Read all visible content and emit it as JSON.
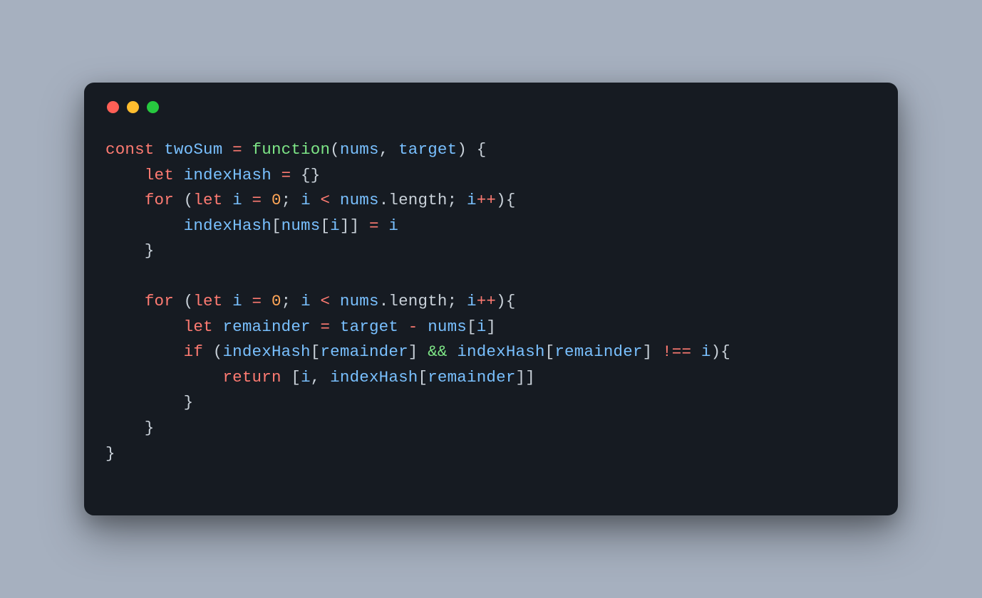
{
  "theme": {
    "background": "#a6b0bf",
    "window_bg": "#161b22",
    "dot_red": "#ff5f56",
    "dot_yellow": "#ffbd2e",
    "dot_green": "#27c93f",
    "text": "#c9d1d9",
    "keyword": "#ff7b72",
    "function": "#7ee787",
    "variable": "#79c0ff",
    "number": "#ffa657",
    "operator": "#ff7b72"
  },
  "code": {
    "language": "javascript",
    "tokens": [
      [
        {
          "t": "const",
          "c": "kw"
        },
        {
          "t": " ",
          "c": "punc"
        },
        {
          "t": "twoSum",
          "c": "var"
        },
        {
          "t": " ",
          "c": "punc"
        },
        {
          "t": "=",
          "c": "op"
        },
        {
          "t": " ",
          "c": "punc"
        },
        {
          "t": "function",
          "c": "green-kw"
        },
        {
          "t": "(",
          "c": "punc"
        },
        {
          "t": "nums",
          "c": "var"
        },
        {
          "t": ", ",
          "c": "punc"
        },
        {
          "t": "target",
          "c": "var"
        },
        {
          "t": ") {",
          "c": "punc"
        }
      ],
      [
        {
          "t": "    ",
          "c": "punc"
        },
        {
          "t": "let",
          "c": "kw"
        },
        {
          "t": " ",
          "c": "punc"
        },
        {
          "t": "indexHash",
          "c": "var"
        },
        {
          "t": " ",
          "c": "punc"
        },
        {
          "t": "=",
          "c": "op"
        },
        {
          "t": " {}",
          "c": "punc"
        }
      ],
      [
        {
          "t": "    ",
          "c": "punc"
        },
        {
          "t": "for",
          "c": "kw"
        },
        {
          "t": " (",
          "c": "punc"
        },
        {
          "t": "let",
          "c": "kw"
        },
        {
          "t": " ",
          "c": "punc"
        },
        {
          "t": "i",
          "c": "var"
        },
        {
          "t": " ",
          "c": "punc"
        },
        {
          "t": "=",
          "c": "op"
        },
        {
          "t": " ",
          "c": "punc"
        },
        {
          "t": "0",
          "c": "num"
        },
        {
          "t": "; ",
          "c": "punc"
        },
        {
          "t": "i",
          "c": "var"
        },
        {
          "t": " ",
          "c": "punc"
        },
        {
          "t": "<",
          "c": "op"
        },
        {
          "t": " ",
          "c": "punc"
        },
        {
          "t": "nums",
          "c": "var"
        },
        {
          "t": ".length; ",
          "c": "punc"
        },
        {
          "t": "i",
          "c": "var"
        },
        {
          "t": "++",
          "c": "op"
        },
        {
          "t": "){",
          "c": "punc"
        }
      ],
      [
        {
          "t": "        ",
          "c": "punc"
        },
        {
          "t": "indexHash",
          "c": "var"
        },
        {
          "t": "[",
          "c": "punc"
        },
        {
          "t": "nums",
          "c": "var"
        },
        {
          "t": "[",
          "c": "punc"
        },
        {
          "t": "i",
          "c": "var"
        },
        {
          "t": "]] ",
          "c": "punc"
        },
        {
          "t": "=",
          "c": "op"
        },
        {
          "t": " ",
          "c": "punc"
        },
        {
          "t": "i",
          "c": "var"
        }
      ],
      [
        {
          "t": "    }",
          "c": "punc"
        }
      ],
      [
        {
          "t": "",
          "c": "punc"
        }
      ],
      [
        {
          "t": "    ",
          "c": "punc"
        },
        {
          "t": "for",
          "c": "kw"
        },
        {
          "t": " (",
          "c": "punc"
        },
        {
          "t": "let",
          "c": "kw"
        },
        {
          "t": " ",
          "c": "punc"
        },
        {
          "t": "i",
          "c": "var"
        },
        {
          "t": " ",
          "c": "punc"
        },
        {
          "t": "=",
          "c": "op"
        },
        {
          "t": " ",
          "c": "punc"
        },
        {
          "t": "0",
          "c": "num"
        },
        {
          "t": "; ",
          "c": "punc"
        },
        {
          "t": "i",
          "c": "var"
        },
        {
          "t": " ",
          "c": "punc"
        },
        {
          "t": "<",
          "c": "op"
        },
        {
          "t": " ",
          "c": "punc"
        },
        {
          "t": "nums",
          "c": "var"
        },
        {
          "t": ".length; ",
          "c": "punc"
        },
        {
          "t": "i",
          "c": "var"
        },
        {
          "t": "++",
          "c": "op"
        },
        {
          "t": "){",
          "c": "punc"
        }
      ],
      [
        {
          "t": "        ",
          "c": "punc"
        },
        {
          "t": "let",
          "c": "kw"
        },
        {
          "t": " ",
          "c": "punc"
        },
        {
          "t": "remainder",
          "c": "var"
        },
        {
          "t": " ",
          "c": "punc"
        },
        {
          "t": "=",
          "c": "op"
        },
        {
          "t": " ",
          "c": "punc"
        },
        {
          "t": "target",
          "c": "var"
        },
        {
          "t": " ",
          "c": "punc"
        },
        {
          "t": "-",
          "c": "op"
        },
        {
          "t": " ",
          "c": "punc"
        },
        {
          "t": "nums",
          "c": "var"
        },
        {
          "t": "[",
          "c": "punc"
        },
        {
          "t": "i",
          "c": "var"
        },
        {
          "t": "]",
          "c": "punc"
        }
      ],
      [
        {
          "t": "        ",
          "c": "punc"
        },
        {
          "t": "if",
          "c": "kw"
        },
        {
          "t": " (",
          "c": "punc"
        },
        {
          "t": "indexHash",
          "c": "var"
        },
        {
          "t": "[",
          "c": "punc"
        },
        {
          "t": "remainder",
          "c": "var"
        },
        {
          "t": "] ",
          "c": "punc"
        },
        {
          "t": "&&",
          "c": "green-kw"
        },
        {
          "t": " ",
          "c": "punc"
        },
        {
          "t": "indexHash",
          "c": "var"
        },
        {
          "t": "[",
          "c": "punc"
        },
        {
          "t": "remainder",
          "c": "var"
        },
        {
          "t": "] ",
          "c": "punc"
        },
        {
          "t": "!==",
          "c": "op"
        },
        {
          "t": " ",
          "c": "punc"
        },
        {
          "t": "i",
          "c": "var"
        },
        {
          "t": "){",
          "c": "punc"
        }
      ],
      [
        {
          "t": "            ",
          "c": "punc"
        },
        {
          "t": "return",
          "c": "kw"
        },
        {
          "t": " [",
          "c": "punc"
        },
        {
          "t": "i",
          "c": "var"
        },
        {
          "t": ", ",
          "c": "punc"
        },
        {
          "t": "indexHash",
          "c": "var"
        },
        {
          "t": "[",
          "c": "punc"
        },
        {
          "t": "remainder",
          "c": "var"
        },
        {
          "t": "]]",
          "c": "punc"
        }
      ],
      [
        {
          "t": "        }",
          "c": "punc"
        }
      ],
      [
        {
          "t": "    }",
          "c": "punc"
        }
      ],
      [
        {
          "t": "}",
          "c": "punc"
        }
      ]
    ]
  }
}
